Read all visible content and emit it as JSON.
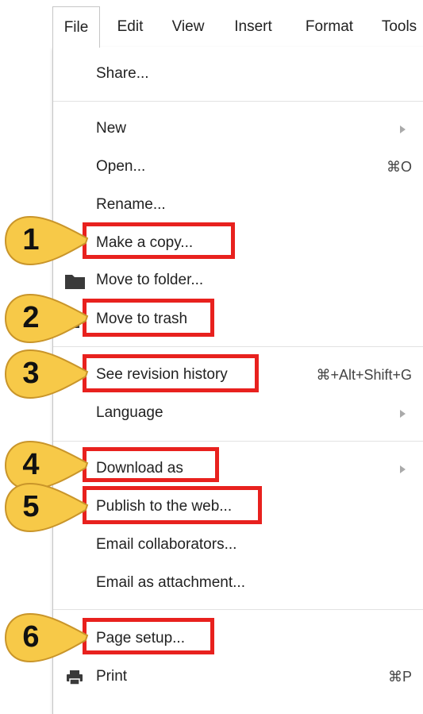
{
  "menubar": {
    "tabs": [
      {
        "label": "File"
      },
      {
        "label": "Edit"
      },
      {
        "label": "View"
      },
      {
        "label": "Insert"
      },
      {
        "label": "Format"
      },
      {
        "label": "Tools"
      }
    ]
  },
  "menu": {
    "share": "Share...",
    "new": "New",
    "open": "Open...",
    "open_shortcut": "⌘O",
    "rename": "Rename...",
    "make_copy": "Make a copy...",
    "move_to_folder": "Move to folder...",
    "move_to_trash": "Move to trash",
    "see_revision_history": "See revision history",
    "revision_shortcut": "⌘+Alt+Shift+G",
    "language": "Language",
    "download_as": "Download as",
    "publish": "Publish to the web...",
    "email_collaborators": "Email collaborators...",
    "email_attachment": "Email as attachment...",
    "page_setup": "Page setup...",
    "print": "Print",
    "print_shortcut": "⌘P"
  },
  "callouts": {
    "c1": "1",
    "c2": "2",
    "c3": "3",
    "c4": "4",
    "c5": "5",
    "c6": "6"
  },
  "colors": {
    "highlight": "#e8211e",
    "callout_fill": "#f7c948",
    "callout_stroke": "#c9952a"
  }
}
